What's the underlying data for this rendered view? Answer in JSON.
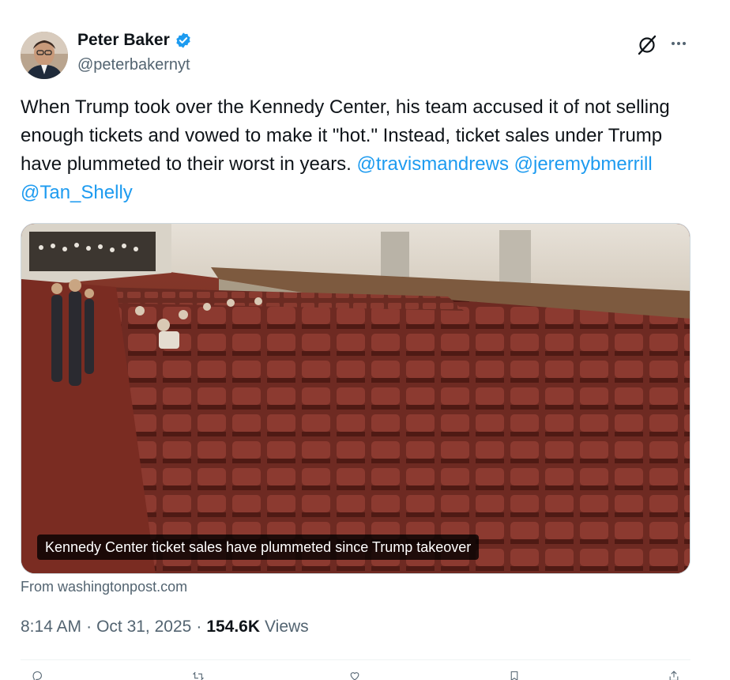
{
  "author": {
    "display_name": "Peter Baker",
    "handle": "@peterbakernyt",
    "verified": true
  },
  "tweet": {
    "text_before": "When Trump took over the Kennedy Center, his team accused it of not selling enough tickets and vowed to make it \"hot.\" Instead, ticket sales under Trump have plummeted to their worst in years.",
    "mentions": [
      "@travismandrews",
      "@jeremybmerrill",
      "@Tan_Shelly"
    ]
  },
  "media": {
    "caption": "Kennedy Center ticket sales have plummeted since Trump takeover",
    "source": "From washingtonpost.com"
  },
  "meta": {
    "time": "8:14 AM",
    "separator": "·",
    "date": "Oct 31, 2025",
    "views_count": "154.6K",
    "views_label": "Views"
  },
  "icons": {
    "grok": "grok-icon",
    "more": "more-icon",
    "verified": "verified-badge-icon",
    "reply": "reply-icon",
    "retweet": "retweet-icon",
    "like": "like-icon",
    "bookmark": "bookmark-icon",
    "share": "share-icon"
  },
  "colors": {
    "accent": "#1d9bf0",
    "text": "#0f1419",
    "secondary": "#536471"
  }
}
